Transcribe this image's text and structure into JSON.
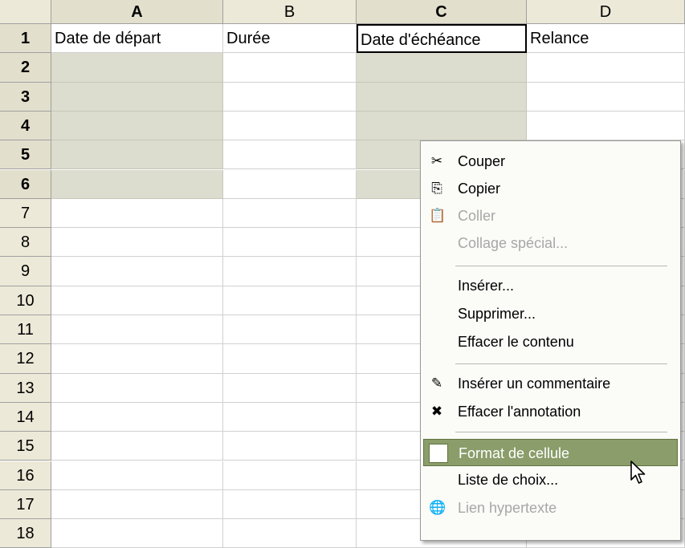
{
  "sheet": {
    "columns": [
      {
        "label": "A",
        "bold": true
      },
      {
        "label": "B",
        "bold": false
      },
      {
        "label": "C",
        "bold": true
      },
      {
        "label": "D",
        "bold": false
      }
    ],
    "rows": [
      "1",
      "2",
      "3",
      "4",
      "5",
      "6",
      "7",
      "8",
      "9",
      "10",
      "11",
      "12",
      "13",
      "14",
      "15",
      "16",
      "17",
      "18"
    ],
    "bold_rows": [
      "1",
      "2",
      "3",
      "4",
      "5",
      "6"
    ],
    "header_cells": [
      "Date de départ",
      "Durée",
      "Date d'échéance",
      "Relance"
    ]
  },
  "context_menu": {
    "items": [
      {
        "label": "Couper",
        "icon": "scissors-icon",
        "glyph": "✂",
        "disabled": false
      },
      {
        "label": "Copier",
        "icon": "copy-icon",
        "glyph": "⎘",
        "disabled": false
      },
      {
        "label": "Coller",
        "icon": "paste-icon",
        "glyph": "📋",
        "disabled": true
      },
      {
        "label": "Collage spécial...",
        "icon": "",
        "glyph": "",
        "disabled": true
      },
      {
        "label": "Insérer...",
        "icon": "",
        "glyph": "",
        "disabled": false
      },
      {
        "label": "Supprimer...",
        "icon": "",
        "glyph": "",
        "disabled": false
      },
      {
        "label": "Effacer le contenu",
        "icon": "",
        "glyph": "",
        "disabled": false
      },
      {
        "label": "Insérer un commentaire",
        "icon": "insert-comment-icon",
        "glyph": "✎",
        "disabled": false
      },
      {
        "label": "Effacer l'annotation",
        "icon": "delete-comment-icon",
        "glyph": "✖",
        "disabled": false
      },
      {
        "label": "Format de cellule",
        "icon": "format-cells-icon",
        "glyph": "▦",
        "disabled": false,
        "highlighted": true
      },
      {
        "label": "Liste de choix...",
        "icon": "",
        "glyph": "",
        "disabled": false
      },
      {
        "label": "Lien hypertexte",
        "icon": "hyperlink-icon",
        "glyph": "🌐",
        "disabled": true
      }
    ]
  },
  "colors": {
    "selection_shade": "#dcdccf",
    "menu_highlight": "#8a9d6a",
    "header_bg": "#ece9d8"
  }
}
